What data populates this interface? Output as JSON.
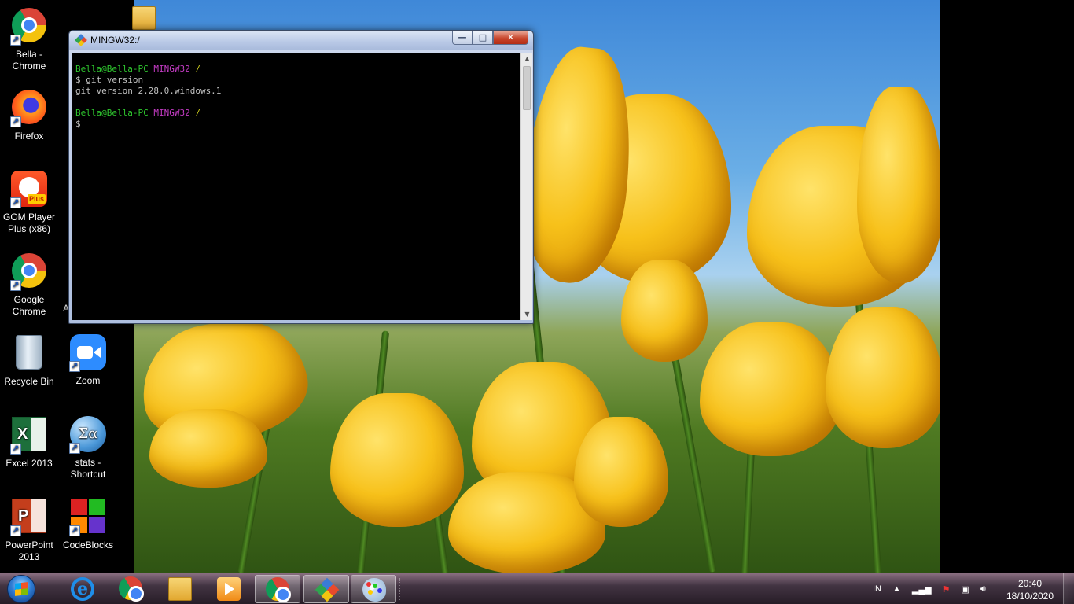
{
  "desktop": {
    "icons": [
      {
        "label": "Bella -\nChrome",
        "icon": "chrome-icon"
      },
      {
        "label": "Firefox",
        "icon": "firefox-icon"
      },
      {
        "label": "GOM Player\nPlus (x86)",
        "icon": "gom-player-icon"
      },
      {
        "label": "Google\nChrome",
        "icon": "chrome-icon"
      },
      {
        "label": "Recycle Bin",
        "icon": "recycle-bin-icon"
      },
      {
        "label": "Zoom",
        "icon": "zoom-icon"
      },
      {
        "label": "Excel 2013",
        "icon": "excel-icon"
      },
      {
        "label": "stats -\nShortcut",
        "icon": "stats-icon"
      },
      {
        "label": "PowerPoint\n2013",
        "icon": "powerpoint-icon"
      },
      {
        "label": "CodeBlocks",
        "icon": "codeblocks-icon"
      }
    ],
    "gom_badge": "Plus",
    "excel_glyph": "X",
    "ppt_glyph": "P",
    "stats_glyph": "Σα",
    "partial_label": "A"
  },
  "window": {
    "title": "MINGW32:/",
    "buttons": {
      "minimize": "—",
      "maximize": "□",
      "close": "✕"
    }
  },
  "terminal": {
    "prompt_user": "Bella@Bella-PC",
    "prompt_env": "MINGW32",
    "prompt_path": "/",
    "command": "$ git version",
    "output": "git version 2.28.0.windows.1",
    "prompt_symbol": "$ "
  },
  "taskbar": {
    "pinned": [
      "internet-explorer-icon",
      "chrome-icon",
      "file-explorer-icon",
      "media-player-icon",
      "chrome-icon",
      "git-bash-icon",
      "paint-icon"
    ],
    "language": "IN",
    "time": "20:40",
    "date": "18/10/2020"
  },
  "colors": {
    "prompt_user": "#2ec42e",
    "prompt_env": "#c33bc3",
    "terminal_bg": "#000000",
    "terminal_text": "#c0c0c0"
  }
}
